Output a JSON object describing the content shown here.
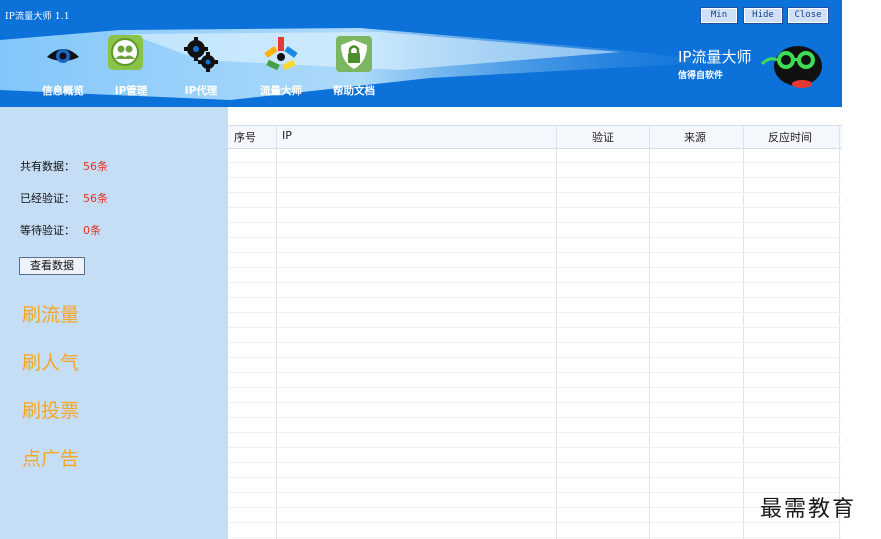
{
  "window": {
    "title": "IP流量大师 1.1",
    "buttons": {
      "min": "Min",
      "hide": "Hide",
      "close": "Close"
    }
  },
  "toolbar": {
    "items": [
      {
        "label": "信息概览",
        "icon": "eye-icon"
      },
      {
        "label": "IP管理",
        "icon": "users-icon",
        "active": true
      },
      {
        "label": "IP代理",
        "icon": "gears-icon"
      },
      {
        "label": "流量大师",
        "icon": "network-icon"
      },
      {
        "label": "帮助文档",
        "icon": "shield-lock-icon"
      }
    ]
  },
  "brand": {
    "name": "IP流量大师",
    "subtitle": "信得自软件"
  },
  "sidebar": {
    "stats": [
      {
        "label": "共有数据：",
        "value": "56条"
      },
      {
        "label": "已经验证：",
        "value": "56条"
      },
      {
        "label": "等待验证：",
        "value": "0条"
      }
    ],
    "view_button": "查看数据",
    "actions": [
      "刷流量",
      "刷人气",
      "刷投票",
      "点广告"
    ]
  },
  "table": {
    "columns": [
      "序号",
      "IP",
      "验证",
      "来源",
      "反应时间"
    ],
    "rows": []
  },
  "watermark": "最需教育",
  "colors": {
    "header": "#0c71d8",
    "sidebar": "#c6ddf6",
    "accent": "#f5a623",
    "stat_value": "#e8301e"
  }
}
